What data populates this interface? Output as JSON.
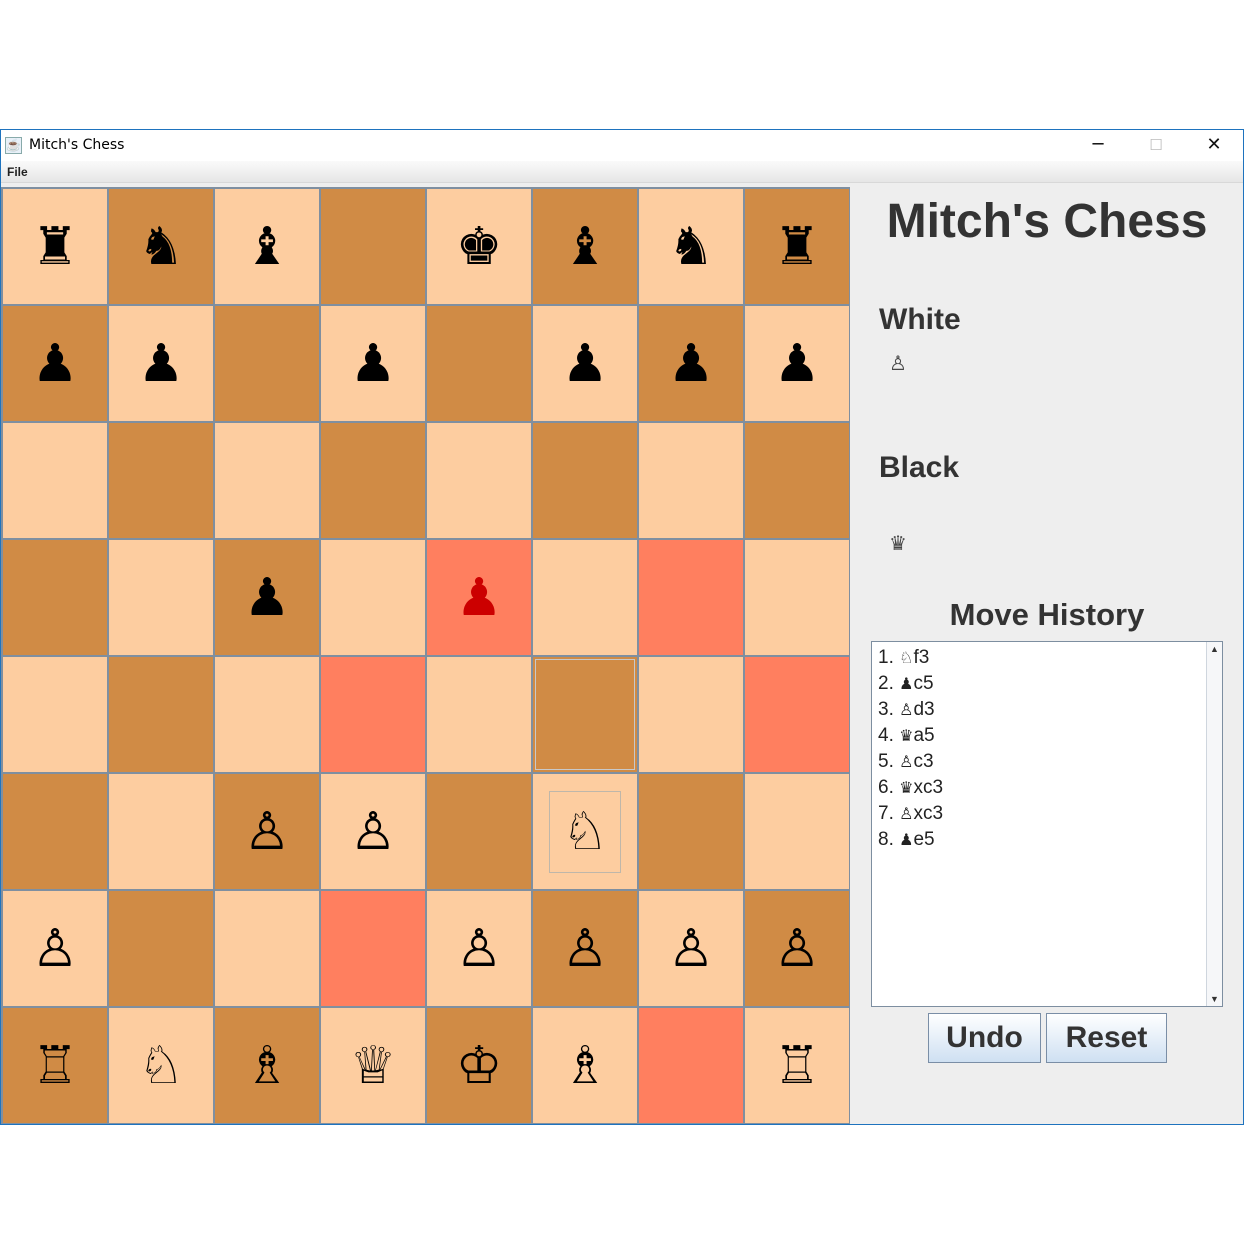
{
  "window": {
    "title": "Mitch's Chess",
    "icon": "java-cup-icon",
    "controls": {
      "minimize": "─",
      "maximize": "☐",
      "close": "✕"
    }
  },
  "menu": {
    "file": "File"
  },
  "board": {
    "rows": [
      [
        {
          "p": "♜",
          "c": "light"
        },
        {
          "p": "♞",
          "c": "dark"
        },
        {
          "p": "♝",
          "c": "light"
        },
        {
          "p": "",
          "c": "dark"
        },
        {
          "p": "♚",
          "c": "light"
        },
        {
          "p": "♝",
          "c": "dark"
        },
        {
          "p": "♞",
          "c": "light"
        },
        {
          "p": "♜",
          "c": "dark"
        }
      ],
      [
        {
          "p": "♟",
          "c": "dark"
        },
        {
          "p": "♟",
          "c": "light"
        },
        {
          "p": "",
          "c": "dark"
        },
        {
          "p": "♟",
          "c": "light"
        },
        {
          "p": "",
          "c": "dark"
        },
        {
          "p": "♟",
          "c": "light"
        },
        {
          "p": "♟",
          "c": "dark"
        },
        {
          "p": "♟",
          "c": "light"
        }
      ],
      [
        {
          "p": "",
          "c": "light"
        },
        {
          "p": "",
          "c": "dark"
        },
        {
          "p": "",
          "c": "light"
        },
        {
          "p": "",
          "c": "dark"
        },
        {
          "p": "",
          "c": "light"
        },
        {
          "p": "",
          "c": "dark"
        },
        {
          "p": "",
          "c": "light"
        },
        {
          "p": "",
          "c": "dark"
        }
      ],
      [
        {
          "p": "",
          "c": "dark"
        },
        {
          "p": "",
          "c": "light"
        },
        {
          "p": "♟",
          "c": "dark"
        },
        {
          "p": "",
          "c": "light"
        },
        {
          "p": "♟",
          "c": "hl",
          "red": true
        },
        {
          "p": "",
          "c": "light"
        },
        {
          "p": "",
          "c": "hl"
        },
        {
          "p": "",
          "c": "light"
        }
      ],
      [
        {
          "p": "",
          "c": "light"
        },
        {
          "p": "",
          "c": "dark"
        },
        {
          "p": "",
          "c": "light"
        },
        {
          "p": "",
          "c": "hl"
        },
        {
          "p": "",
          "c": "light"
        },
        {
          "p": "",
          "c": "dark",
          "sel": true
        },
        {
          "p": "",
          "c": "light"
        },
        {
          "p": "",
          "c": "hl"
        }
      ],
      [
        {
          "p": "",
          "c": "dark"
        },
        {
          "p": "",
          "c": "light"
        },
        {
          "p": "♙",
          "c": "dark"
        },
        {
          "p": "♙",
          "c": "light"
        },
        {
          "p": "",
          "c": "dark"
        },
        {
          "p": "♘",
          "c": "light",
          "boxed": true
        },
        {
          "p": "",
          "c": "dark"
        },
        {
          "p": "",
          "c": "light"
        }
      ],
      [
        {
          "p": "♙",
          "c": "light"
        },
        {
          "p": "",
          "c": "dark"
        },
        {
          "p": "",
          "c": "light"
        },
        {
          "p": "",
          "c": "hl"
        },
        {
          "p": "♙",
          "c": "light"
        },
        {
          "p": "♙",
          "c": "dark"
        },
        {
          "p": "♙",
          "c": "light"
        },
        {
          "p": "♙",
          "c": "dark"
        }
      ],
      [
        {
          "p": "♖",
          "c": "dark"
        },
        {
          "p": "♘",
          "c": "light"
        },
        {
          "p": "♗",
          "c": "dark"
        },
        {
          "p": "♕",
          "c": "light"
        },
        {
          "p": "♔",
          "c": "dark"
        },
        {
          "p": "♗",
          "c": "light"
        },
        {
          "p": "",
          "c": "hl"
        },
        {
          "p": "♖",
          "c": "light"
        }
      ]
    ]
  },
  "sidebar": {
    "title": "Mitch's Chess",
    "white_label": "White",
    "white_captured": "♙",
    "black_label": "Black",
    "black_captured": "♛",
    "history_title": "Move History",
    "moves": [
      {
        "num": "1.",
        "piece": "♘",
        "sq": "f3"
      },
      {
        "num": "2.",
        "piece": "♟",
        "sq": "c5"
      },
      {
        "num": "3.",
        "piece": "♙",
        "sq": "d3"
      },
      {
        "num": "4.",
        "piece": "♛",
        "sq": "a5"
      },
      {
        "num": "5.",
        "piece": "♙",
        "sq": "c3"
      },
      {
        "num": "6.",
        "piece": "♛",
        "sq": "xc3"
      },
      {
        "num": "7.",
        "piece": "♙",
        "sq": "xc3"
      },
      {
        "num": "8.",
        "piece": "♟",
        "sq": "e5"
      }
    ],
    "undo_label": "Undo",
    "reset_label": "Reset"
  }
}
